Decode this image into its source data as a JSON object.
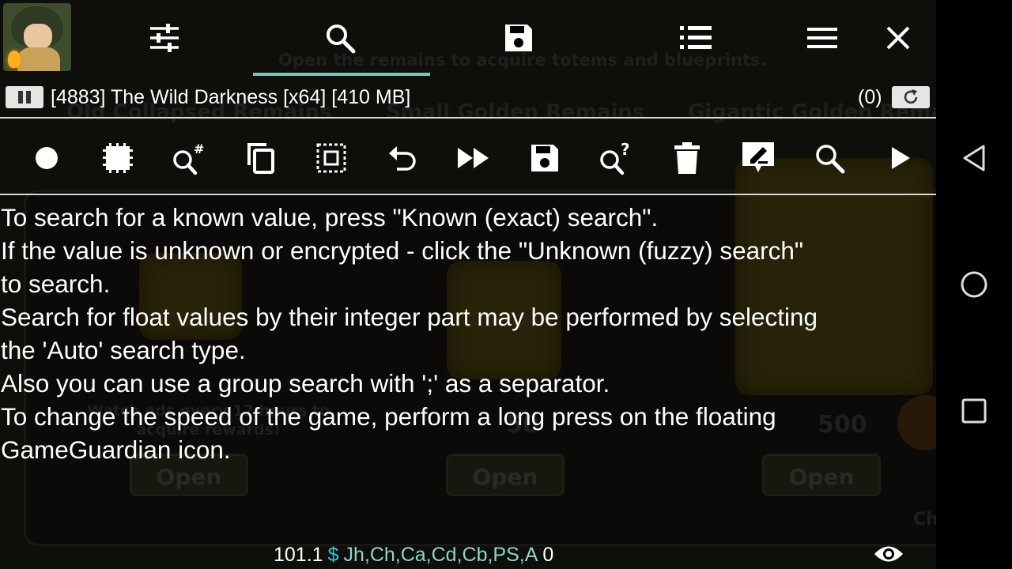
{
  "game_background": {
    "subtitle": "Open the remains to acquire totems and blueprints.",
    "titles": [
      "Old Collapsed Remains",
      "Small Golden Remains",
      "Gigantic Golden Remai"
    ],
    "watch_text": "Watch ads every 12 hours to\nacquire rewards!",
    "prices": [
      "50",
      "500"
    ],
    "open_label": "Open",
    "corner_text": "Ch"
  },
  "toolbar_top": {
    "items": [
      {
        "name": "settings-sliders-icon"
      },
      {
        "name": "search-icon",
        "active": true
      },
      {
        "name": "save-icon"
      },
      {
        "name": "list-icon"
      },
      {
        "name": "menu-icon"
      },
      {
        "name": "close-icon"
      }
    ],
    "accent_color": "#7fc4b8"
  },
  "process": {
    "label": "[4883] The Wild Darkness [x64] [410 MB]",
    "count": "(0)"
  },
  "toolbar_tools": {
    "items": [
      "record-icon",
      "memory-range-icon",
      "search-number-icon",
      "copy-icon",
      "select-all-icon",
      "undo-icon",
      "fast-forward-icon",
      "save-list-icon",
      "fuzzy-search-icon",
      "delete-icon",
      "edit-icon",
      "refine-search-icon",
      "run-icon"
    ]
  },
  "help": {
    "lines": [
      "To search for a known value, press \"Known (exact) search\".",
      "If the value is unknown or encrypted - click the \"Unknown (fuzzy) search\"",
      "to search.",
      "Search for float values by their integer part may be performed by selecting",
      "the 'Auto' search type.",
      "Also you can use a group search with ';' as a separator.",
      "To change the speed of the game, perform a long press on the floating",
      "GameGuardian icon."
    ]
  },
  "status": {
    "version": "101.1",
    "dollar": "$",
    "flags": "Jh,Ch,Ca,Cd,Cb,PS,A",
    "zero": "0"
  },
  "nav": {
    "items": [
      "back-icon",
      "home-icon",
      "recents-icon"
    ]
  }
}
